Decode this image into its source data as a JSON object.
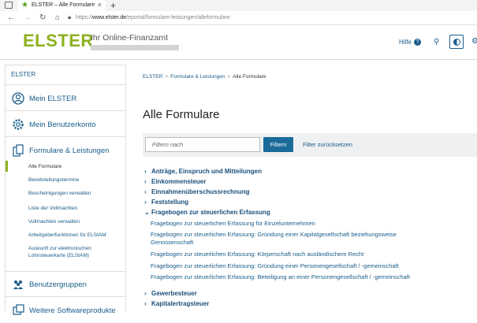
{
  "browser": {
    "tab_title": "ELSTER – Alle Formulare",
    "tab_close": "×",
    "new_tab": "+",
    "url_prefix": "https://",
    "url_host": "www.elster.de",
    "url_path": "/eportal/formulare-leistungen/alleformulare"
  },
  "header": {
    "logo": "ELSTER",
    "tagline": "Ihr Online-Finanzamt",
    "help_label": "Hilfe",
    "help_glyph": "?"
  },
  "sidebar": {
    "title": "ELSTER",
    "main_items": [
      {
        "label": "Mein ELSTER",
        "icon": "user-circle-icon"
      },
      {
        "label": "Mein Benutzerkonto",
        "icon": "gear-icon"
      },
      {
        "label": "Formulare & Leistungen",
        "icon": "documents-icon"
      },
      {
        "label": "Benutzergruppen",
        "icon": "user-group-icon"
      },
      {
        "label": "Weitere Softwareprodukte",
        "icon": "software-icon"
      }
    ],
    "sub_items": [
      "Alle Formulare",
      "Bereitstellungstermine",
      "Bescheinigungen verwalten",
      "Liste der Vollmachten",
      "Vollmachten verwalten",
      "Arbeitgeberfunktionen für ELStAM",
      "Auskunft zur elektronischen Lohnsteuerkarte (ELStAM)"
    ]
  },
  "breadcrumb": {
    "items": [
      "ELSTER",
      "Formulare & Leistungen"
    ],
    "current": "Alle Formulare",
    "separator": ">"
  },
  "main": {
    "title": "Alle Formulare",
    "filter_placeholder": "Filtern nach",
    "filter_button": "Filtern",
    "filter_reset": "Filter zurücksetzen",
    "categories": [
      {
        "label": "Anträge, Einspruch und Mitteilungen",
        "expanded": false,
        "chevron": "›"
      },
      {
        "label": "Einkommensteuer",
        "expanded": false,
        "chevron": "›"
      },
      {
        "label": "Einnahmenüberschussrechnung",
        "expanded": false,
        "chevron": "›"
      },
      {
        "label": "Feststellung",
        "expanded": false,
        "chevron": "›"
      },
      {
        "label": "Fragebogen zur steuerlichen Erfassung",
        "expanded": true,
        "chevron": "⌄"
      },
      {
        "label": "Gewerbesteuer",
        "expanded": false,
        "chevron": "›"
      },
      {
        "label": "Kapitalertragsteuer",
        "expanded": false,
        "chevron": "›"
      }
    ],
    "forms": [
      "Fragebogen zur steuerlichen Erfassung für Einzelunternehmen",
      "Fragebogen zur steuerlichen Erfassung: Gründung einer Kapitalgesellschaft beziehungsweise Genossenschaft",
      "Fragebogen zur steuerlichen Erfassung: Körperschaft nach ausländischem Recht",
      "Fragebogen zur steuerlichen Erfassung: Gründung einer Personengesellschaft / -gemeinschaft",
      "Fragebogen zur steuerlichen Erfassung: Beteiligung an einer Personengesellschaft / -gemeinschaft"
    ]
  },
  "colors": {
    "brand_green": "#8cb21e",
    "link_blue": "#1a5c8a",
    "button_blue": "#1a6a9a"
  }
}
